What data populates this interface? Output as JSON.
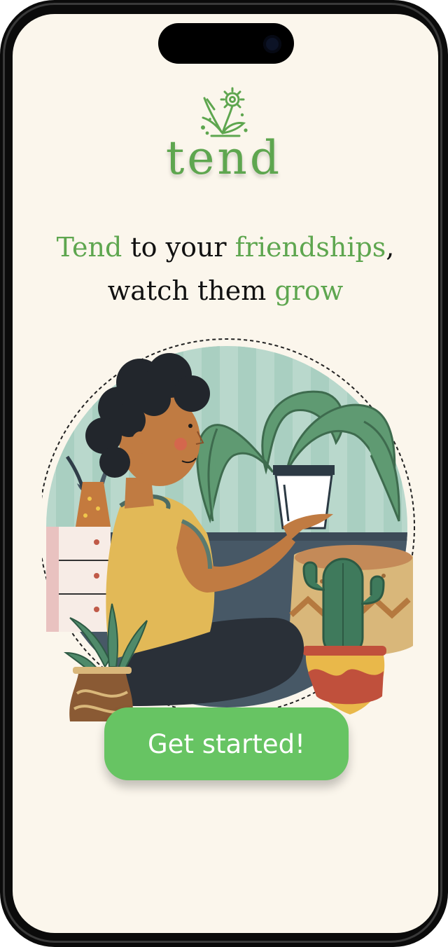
{
  "brand": {
    "name": "tend",
    "logo_icon": "sprouting-flower-icon"
  },
  "headline": {
    "line1": {
      "part1": "Tend",
      "part2": " to your ",
      "part3": "friendships",
      "part4": ","
    },
    "line2": {
      "part1": "watch them ",
      "part2": "grow"
    }
  },
  "illustration": {
    "icon": "person-holding-plant-illustration"
  },
  "cta": {
    "label": "Get started!"
  },
  "colors": {
    "accent_green": "#5ea64f",
    "button_green": "#67c463",
    "background": "#fbf6ec"
  }
}
